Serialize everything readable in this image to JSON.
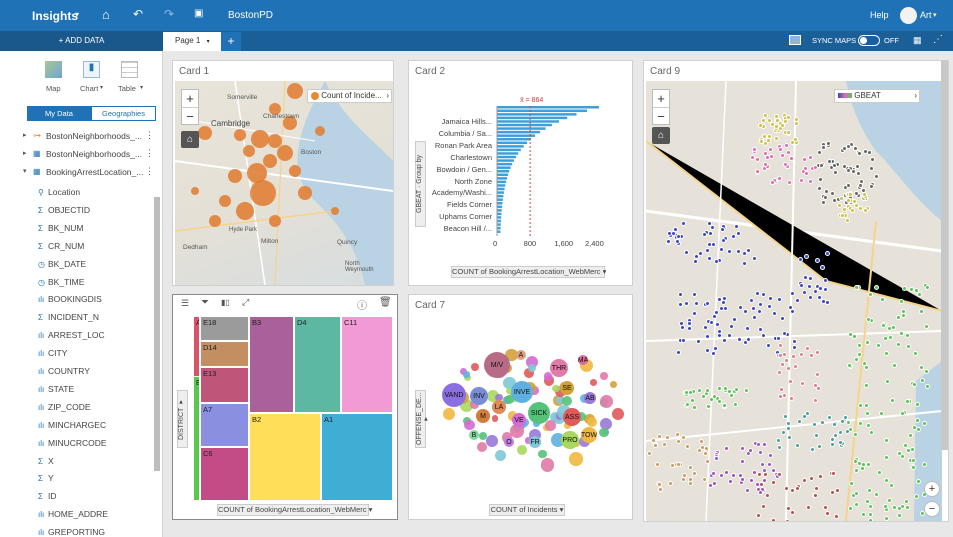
{
  "topbar": {
    "app": "Insights",
    "doc": "BostonPD",
    "help": "Help",
    "user": "Art"
  },
  "subbar": {
    "add_data": "+ ADD DATA",
    "page_tab": "Page 1",
    "add_page": "+",
    "sync_maps": "SYNC MAPS",
    "toggle": "OFF"
  },
  "leftpanel": {
    "viz": {
      "map": "Map",
      "chart": "Chart",
      "table": "Table"
    },
    "tabs": {
      "mydata": "My Data",
      "geographies": "Geographies"
    },
    "datasets": [
      {
        "label": "BostonNeighborhoods_..."
      },
      {
        "label": "BostonNeighborhoods_..."
      },
      {
        "label": "BookingArrestLocation_..."
      }
    ],
    "fields": [
      {
        "type": "loc",
        "name": "Location"
      },
      {
        "type": "Σ",
        "name": "OBJECTID"
      },
      {
        "type": "Σ",
        "name": "BK_NUM"
      },
      {
        "type": "Σ",
        "name": "CR_NUM"
      },
      {
        "type": "date",
        "name": "BK_DATE"
      },
      {
        "type": "date",
        "name": "BK_TIME"
      },
      {
        "type": "str",
        "name": "BOOKINGDIS"
      },
      {
        "type": "Σ",
        "name": "INCIDENT_N"
      },
      {
        "type": "str",
        "name": "ARREST_LOC"
      },
      {
        "type": "str",
        "name": "CITY"
      },
      {
        "type": "str",
        "name": "COUNTRY"
      },
      {
        "type": "str",
        "name": "STATE"
      },
      {
        "type": "str",
        "name": "ZIP_CODE"
      },
      {
        "type": "str",
        "name": "MINCHARGEC"
      },
      {
        "type": "str",
        "name": "MINUCRCODE"
      },
      {
        "type": "Σ",
        "name": "X"
      },
      {
        "type": "Σ",
        "name": "Y"
      },
      {
        "type": "Σ",
        "name": "ID"
      },
      {
        "type": "str",
        "name": "HOME_ADDRE"
      },
      {
        "type": "str",
        "name": "GREPORTING"
      }
    ]
  },
  "card1": {
    "title": "Card 1",
    "legend": "Count of Incide...",
    "places": [
      "Somerville",
      "Charlestown",
      "Cambridge",
      "Boston",
      "Quincy",
      "Dedham",
      "Milton",
      "North Weymouth",
      "Hyde Park"
    ]
  },
  "card2": {
    "title": "Card 2",
    "annotation": "x̄ = 864",
    "group_by": "GBEAT · Group by",
    "x_btn": "COUNT of BookingArrestLocation_WebMerc ▾",
    "labels": [
      "Jamaica Hills...",
      "Columbia / Sa...",
      "Ronan Park Area",
      "Charlestown",
      "Bowdoin / Gen...",
      "North Zone",
      "Academy/Washi...",
      "Fields Corner",
      "Uphams Corner",
      "Beacon Hill /..."
    ],
    "ticks": [
      "0",
      "800",
      "1,600",
      "2,400"
    ]
  },
  "card9": {
    "title": "Card 9",
    "legend": "GBEAT"
  },
  "card4": {
    "y_btn": "DISTRICT ▾",
    "x_btn": "COUNT of BookingArrestLocation_WebMerc ▾",
    "cells": [
      {
        "label": "A",
        "color": "#d9546a"
      },
      {
        "label": "E18",
        "color": "#9b9b9b"
      },
      {
        "label": "D14",
        "color": "#c48e63"
      },
      {
        "label": "E13",
        "color": "#c0557a"
      },
      {
        "label": "A7",
        "color": "#8b8fe0"
      },
      {
        "label": "C6",
        "color": "#c44c86"
      },
      {
        "label": "E",
        "color": "#59c84d"
      },
      {
        "label": "B3",
        "color": "#a8619b"
      },
      {
        "label": "D4",
        "color": "#5cb8a0"
      },
      {
        "label": "C11",
        "color": "#f29ad6"
      },
      {
        "label": "B2",
        "color": "#ffdf5a"
      },
      {
        "label": "A1",
        "color": "#3eaed4"
      }
    ]
  },
  "card7": {
    "title": "Card 7",
    "y_btn": "OFFENSE_DE... ▾",
    "x_btn": "COUNT of Incidents ▾",
    "bubbles": [
      {
        "label": "M/V",
        "color": "#b86b86"
      },
      {
        "label": "VAND",
        "color": "#8b6fe0"
      },
      {
        "label": "INV",
        "color": "#7a8cd8"
      },
      {
        "label": "INVE",
        "color": "#5fb0e0"
      },
      {
        "label": "SICK",
        "color": "#55c27a"
      },
      {
        "label": "THR",
        "color": "#e07aa8"
      },
      {
        "label": "PRO",
        "color": "#a8d85e"
      },
      {
        "label": "TOW",
        "color": "#f0b840"
      },
      {
        "label": "VE",
        "color": "#d46ad4"
      },
      {
        "label": "ASS",
        "color": "#e05a5a"
      },
      {
        "label": "LA",
        "color": "#e08a5a"
      },
      {
        "label": "M",
        "color": "#d47c3a"
      },
      {
        "label": "SE",
        "color": "#d4a03a"
      },
      {
        "label": "AB",
        "color": "#9a78d8"
      },
      {
        "label": "FR",
        "color": "#80c8d8"
      },
      {
        "label": "A",
        "color": "#e0a080"
      },
      {
        "label": "O",
        "color": "#c080e0"
      },
      {
        "label": "MA",
        "color": "#e06a9a"
      },
      {
        "label": "B",
        "color": "#80d8a0"
      }
    ]
  }
}
